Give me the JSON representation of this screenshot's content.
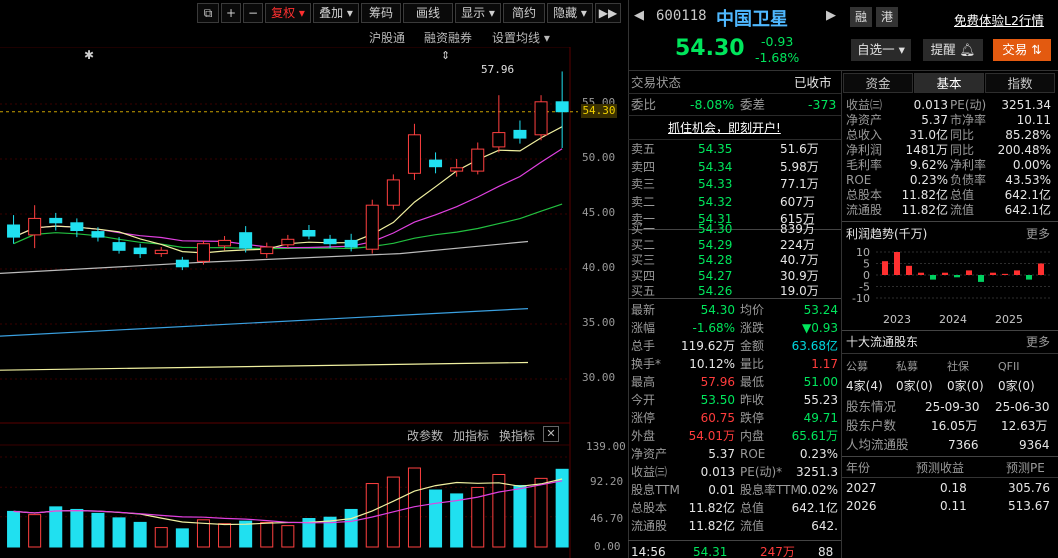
{
  "toolbar": {
    "buttons": [
      "+",
      "−",
      "复权",
      "叠加",
      "筹码",
      "画线",
      "显示",
      "简约",
      "隐藏",
      "▶▶"
    ],
    "sub_items": [
      "沪股通",
      "融资融券",
      "设置均线"
    ]
  },
  "chart": {
    "price_labels": [
      "55.00",
      "50.00",
      "45.00",
      "40.00",
      "35.00",
      "30.00"
    ],
    "current_price_tag": "54.30",
    "high_annotation": "57.96",
    "volume_labels": [
      "139.00",
      "92.20",
      "46.70",
      "0.00"
    ],
    "indicator_buttons": [
      "改参数",
      "加指标",
      "换指标"
    ],
    "close_icon": "✕",
    "candles": [
      {
        "o": 44.0,
        "c": 42.9,
        "h": 44.9,
        "l": 42.3
      },
      {
        "o": 43.1,
        "c": 44.6,
        "h": 45.8,
        "l": 41.9
      },
      {
        "o": 44.6,
        "c": 44.2,
        "h": 45.1,
        "l": 43.5
      },
      {
        "o": 44.2,
        "c": 43.5,
        "h": 44.6,
        "l": 42.9
      },
      {
        "o": 43.4,
        "c": 42.9,
        "h": 43.8,
        "l": 42.5
      },
      {
        "o": 42.4,
        "c": 41.7,
        "h": 42.9,
        "l": 41.4
      },
      {
        "o": 41.9,
        "c": 41.4,
        "h": 42.3,
        "l": 41.0
      },
      {
        "o": 41.4,
        "c": 41.7,
        "h": 42.0,
        "l": 41.1
      },
      {
        "o": 40.8,
        "c": 40.2,
        "h": 41.1,
        "l": 39.9
      },
      {
        "o": 40.7,
        "c": 42.3,
        "h": 42.6,
        "l": 40.4
      },
      {
        "o": 42.1,
        "c": 42.6,
        "h": 43.0,
        "l": 41.7
      },
      {
        "o": 43.3,
        "c": 41.9,
        "h": 43.9,
        "l": 41.5
      },
      {
        "o": 41.4,
        "c": 42.0,
        "h": 42.4,
        "l": 41.0
      },
      {
        "o": 42.2,
        "c": 42.7,
        "h": 43.1,
        "l": 41.9
      },
      {
        "o": 43.5,
        "c": 43.0,
        "h": 44.0,
        "l": 42.7
      },
      {
        "o": 42.7,
        "c": 42.3,
        "h": 43.1,
        "l": 41.9
      },
      {
        "o": 42.6,
        "c": 42.0,
        "h": 43.2,
        "l": 41.6
      },
      {
        "o": 41.8,
        "c": 45.8,
        "h": 46.3,
        "l": 41.4
      },
      {
        "o": 45.8,
        "c": 48.1,
        "h": 48.6,
        "l": 45.4
      },
      {
        "o": 48.7,
        "c": 52.2,
        "h": 53.2,
        "l": 48.1
      },
      {
        "o": 49.9,
        "c": 49.3,
        "h": 50.6,
        "l": 48.7
      },
      {
        "o": 48.9,
        "c": 49.2,
        "h": 50.0,
        "l": 48.4
      },
      {
        "o": 48.9,
        "c": 50.9,
        "h": 51.5,
        "l": 48.6
      },
      {
        "o": 51.1,
        "c": 52.4,
        "h": 55.8,
        "l": 50.6
      },
      {
        "o": 52.6,
        "c": 51.9,
        "h": 53.5,
        "l": 51.4
      },
      {
        "o": 52.2,
        "c": 55.2,
        "h": 55.8,
        "l": 51.7
      },
      {
        "o": 55.2,
        "c": 54.3,
        "h": 57.96,
        "l": 51.0
      }
    ],
    "volumes": [
      {
        "v": 55,
        "up": false
      },
      {
        "v": 50,
        "up": true
      },
      {
        "v": 62,
        "up": false
      },
      {
        "v": 58,
        "up": false
      },
      {
        "v": 52,
        "up": false
      },
      {
        "v": 45,
        "up": false
      },
      {
        "v": 38,
        "up": false
      },
      {
        "v": 30,
        "up": true
      },
      {
        "v": 28,
        "up": false
      },
      {
        "v": 42,
        "up": true
      },
      {
        "v": 36,
        "up": true
      },
      {
        "v": 40,
        "up": false
      },
      {
        "v": 38,
        "up": true
      },
      {
        "v": 33,
        "up": true
      },
      {
        "v": 44,
        "up": false
      },
      {
        "v": 46,
        "up": false
      },
      {
        "v": 58,
        "up": false
      },
      {
        "v": 98,
        "up": true
      },
      {
        "v": 108,
        "up": true
      },
      {
        "v": 122,
        "up": true
      },
      {
        "v": 88,
        "up": false
      },
      {
        "v": 82,
        "up": false
      },
      {
        "v": 92,
        "up": true
      },
      {
        "v": 112,
        "up": true
      },
      {
        "v": 95,
        "up": false
      },
      {
        "v": 106,
        "up": true
      },
      {
        "v": 120,
        "up": false
      }
    ]
  },
  "header": {
    "code": "600118",
    "name": "中国卫星",
    "badge1": "融",
    "badge2": "港",
    "l2_link": "免费体验L2行情",
    "price": "54.30",
    "change": "-0.93",
    "change_pct": "-1.68%",
    "btn_watch": "自选一",
    "btn_alert": "提醒",
    "btn_trade": "交易"
  },
  "status": {
    "label": "交易状态",
    "value": "已收市"
  },
  "weibi": {
    "label": "委比",
    "value": "-8.08%",
    "label2": "委差",
    "value2": "-373"
  },
  "promo": "抓住机会，即刻开户!",
  "asks": [
    {
      "label": "卖五",
      "price": "54.35",
      "vol": "51.6万"
    },
    {
      "label": "卖四",
      "price": "54.34",
      "vol": "5.98万"
    },
    {
      "label": "卖三",
      "price": "54.33",
      "vol": "77.1万"
    },
    {
      "label": "卖二",
      "price": "54.32",
      "vol": "607万"
    },
    {
      "label": "卖一",
      "price": "54.31",
      "vol": "615万"
    }
  ],
  "bids": [
    {
      "label": "买一",
      "price": "54.30",
      "vol": "839万"
    },
    {
      "label": "买二",
      "price": "54.29",
      "vol": "224万"
    },
    {
      "label": "买三",
      "price": "54.28",
      "vol": "40.7万"
    },
    {
      "label": "买四",
      "price": "54.27",
      "vol": "30.9万"
    },
    {
      "label": "买五",
      "price": "54.26",
      "vol": "19.0万"
    }
  ],
  "quote": [
    {
      "l1": "最新",
      "v1": "54.30",
      "c1": "green",
      "l2": "均价",
      "v2": "53.24",
      "c2": "green"
    },
    {
      "l1": "涨幅",
      "v1": "-1.68%",
      "c1": "green",
      "l2": "涨跌",
      "v2": "▼0.93",
      "c2": "green"
    },
    {
      "l1": "总手",
      "v1": "119.62万",
      "c1": "white",
      "l2": "金额",
      "v2": "63.68亿",
      "c2": "cyan"
    },
    {
      "l1": "换手*",
      "v1": "10.12%",
      "c1": "white",
      "l2": "量比",
      "v2": "1.17",
      "c2": "red"
    },
    {
      "l1": "最高",
      "v1": "57.96",
      "c1": "red",
      "l2": "最低",
      "v2": "51.00",
      "c2": "green"
    },
    {
      "l1": "今开",
      "v1": "53.50",
      "c1": "green",
      "l2": "昨收",
      "v2": "55.23",
      "c2": "white"
    },
    {
      "l1": "涨停",
      "v1": "60.75",
      "c1": "red",
      "l2": "跌停",
      "v2": "49.71",
      "c2": "green"
    },
    {
      "l1": "外盘",
      "v1": "54.01万",
      "c1": "red",
      "l2": "内盘",
      "v2": "65.61万",
      "c2": "green"
    },
    {
      "l1": "净资产",
      "v1": "5.37",
      "c1": "white",
      "l2": "ROE",
      "v2": "0.23%",
      "c2": "white"
    },
    {
      "l1": "收益㈢",
      "v1": "0.013",
      "c1": "white",
      "l2": "PE(动)*",
      "v2": "3251.3",
      "c2": "white"
    },
    {
      "l1": "股息TTM",
      "v1": "0.01",
      "c1": "white",
      "l2": "股息率TTM",
      "v2": "0.02%",
      "c2": "white"
    },
    {
      "l1": "总股本",
      "v1": "11.82亿",
      "c1": "white",
      "l2": "总值",
      "v2": "642.1亿",
      "c2": "white"
    },
    {
      "l1": "流通股",
      "v1": "11.82亿",
      "c1": "white",
      "l2": "流值",
      "v2": "642.",
      "c2": "white"
    }
  ],
  "tick": {
    "time": "14:56",
    "price": "54.31",
    "vol": "247万",
    "n": "88"
  },
  "tabs": [
    "资金",
    "基本",
    "指数"
  ],
  "fundamentals": [
    {
      "l1": "收益㈢",
      "v1": "0.013",
      "l2": "PE(动)",
      "v2": "3251.34"
    },
    {
      "l1": "净资产",
      "v1": "5.37",
      "l2": "市净率",
      "v2": "10.11"
    },
    {
      "l1": "总收入",
      "v1": "31.0亿",
      "l2": "同比",
      "v2": "85.28%"
    },
    {
      "l1": "净利润",
      "v1": "1481万",
      "l2": "同比",
      "v2": "200.48%"
    },
    {
      "l1": "毛利率",
      "v1": "9.62%",
      "l2": "净利率",
      "v2": "0.00%"
    },
    {
      "l1": "ROE",
      "v1": "0.23%",
      "l2": "负债率",
      "v2": "43.53%"
    },
    {
      "l1": "总股本",
      "v1": "11.82亿",
      "l2": "总值",
      "v2": "642.1亿"
    },
    {
      "l1": "流通股",
      "v1": "11.82亿",
      "l2": "流值",
      "v2": "642.1亿"
    }
  ],
  "profit_trend": {
    "title": "利润趋势(千万)",
    "more": "更多",
    "yticks": [
      "10",
      "5",
      "0",
      "-5",
      "-10"
    ],
    "years": [
      "2023",
      "2024",
      "2025"
    ],
    "bars": [
      6,
      10,
      4,
      1,
      -2,
      1,
      -1,
      2,
      -3,
      1,
      0.5,
      2,
      -2,
      5
    ],
    "colors": [
      "#ff3030",
      "#00d060"
    ]
  },
  "holders": {
    "title": "十大流通股东",
    "more": "更多",
    "cols": [
      "公募",
      "私募",
      "社保",
      "QFII"
    ],
    "vals": [
      "4家(4)",
      "0家(0)",
      "0家(0)",
      "0家(0)"
    ],
    "r1": {
      "l": "股东情况",
      "a": "25-09-30",
      "b": "25-06-30"
    },
    "r2": {
      "l": "股东户数",
      "a": "16.05万",
      "b": "12.63万"
    },
    "r3": {
      "l": "人均流通股",
      "a": "7366",
      "b": "9364"
    }
  },
  "forecast": {
    "cols": [
      "年份",
      "预测收益",
      "预测PE"
    ],
    "rows": [
      {
        "y": "2027",
        "e": "0.18",
        "pe": "305.76"
      },
      {
        "y": "2026",
        "e": "0.11",
        "pe": "513.67"
      }
    ]
  }
}
